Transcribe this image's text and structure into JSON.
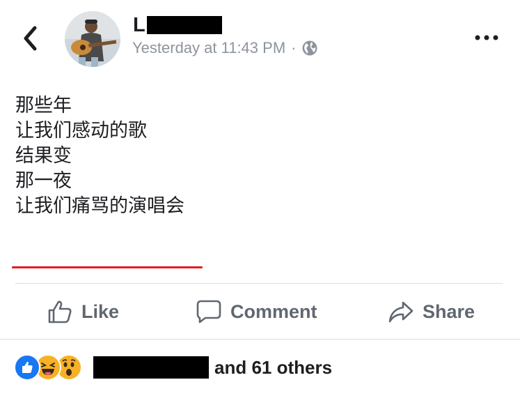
{
  "header": {
    "author_initial": "L",
    "timestamp": "Yesterday at 11:43 PM",
    "separator": "·",
    "back_icon": "chevron-left-icon",
    "privacy_icon": "globe-icon",
    "more_icon": "more-horizontal-icon"
  },
  "post": {
    "lines": [
      "那些年",
      "让我们感动的歌",
      "",
      "结果变",
      "",
      "那一夜",
      "让我们痛骂的演唱会"
    ]
  },
  "actions": {
    "like": "Like",
    "comment": "Comment",
    "share": "Share"
  },
  "reactions": {
    "icons": [
      "like-reaction-icon",
      "haha-reaction-icon",
      "wow-reaction-icon"
    ],
    "others_text": "and 61 others"
  },
  "colors": {
    "accent": "#1877f2",
    "underline": "#e41b23",
    "muted": "#606770"
  }
}
